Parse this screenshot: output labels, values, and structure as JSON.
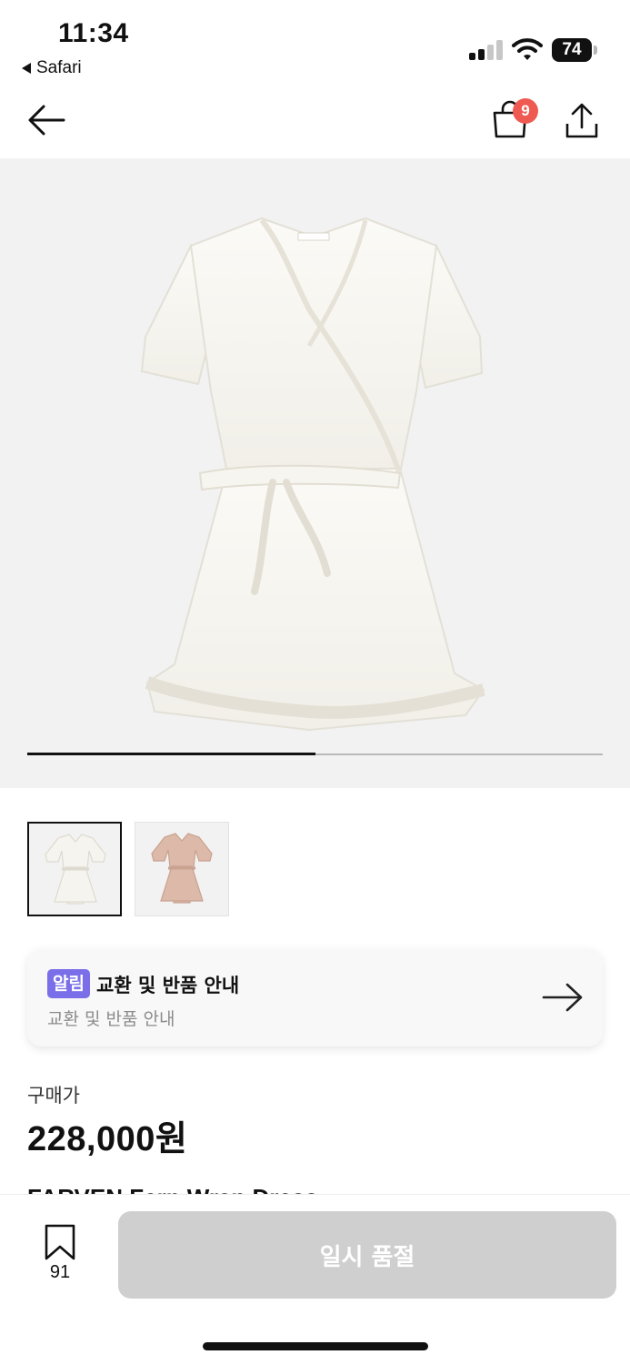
{
  "status_bar": {
    "time": "11:34",
    "back_app_label": "Safari",
    "battery_level": "74",
    "signal_bars": 2,
    "signal_bars_total": 4
  },
  "nav": {
    "back_icon": "back-arrow-icon",
    "cart_icon": "shopping-bag-icon",
    "cart_badge_count": "9",
    "share_icon": "share-icon"
  },
  "gallery": {
    "image_count": 2,
    "current_index": 1,
    "progress_fraction": 0.5,
    "main_image_label": "FARVEN"
  },
  "thumbnails": [
    {
      "color": "#f5f3ee",
      "selected": true
    },
    {
      "color": "#dcb9a8",
      "selected": false
    }
  ],
  "notice": {
    "tag": "알림",
    "title": "교환 및 반품 안내",
    "subtitle": "교환 및 반품 안내",
    "arrow_icon": "arrow-right-icon"
  },
  "price": {
    "label": "구매가",
    "value": "228,000원"
  },
  "peek_title": "FARVEN Fern Wrap Dress",
  "bottom": {
    "bookmark_icon": "bookmark-icon",
    "bookmark_count": "91",
    "buy_button_label": "일시 품절"
  },
  "colors": {
    "badge": "#ee5a52",
    "notice_tag": "#7a6fe8",
    "disabled_button": "#cfcfcf",
    "gallery_bg": "#f2f2f2"
  }
}
